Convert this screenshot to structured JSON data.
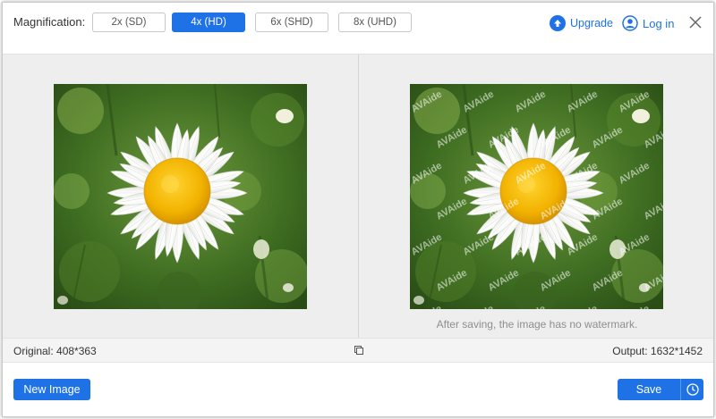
{
  "magnification": {
    "label": "Magnification:",
    "options": [
      "2x (SD)",
      "4x (HD)",
      "6x (SHD)",
      "8x (UHD)"
    ],
    "selected": "4x (HD)"
  },
  "header": {
    "upgrade_label": "Upgrade",
    "login_label": "Log in"
  },
  "preview": {
    "watermark_text": "AVAide",
    "watermark_note": "After saving, the image has no watermark."
  },
  "info": {
    "original": "Original: 408*363",
    "output": "Output: 1632*1452"
  },
  "actions": {
    "new_image_label": "New Image",
    "save_label": "Save"
  },
  "colors": {
    "accent": "#1f72e6",
    "stage_bg": "#eeeeee"
  }
}
